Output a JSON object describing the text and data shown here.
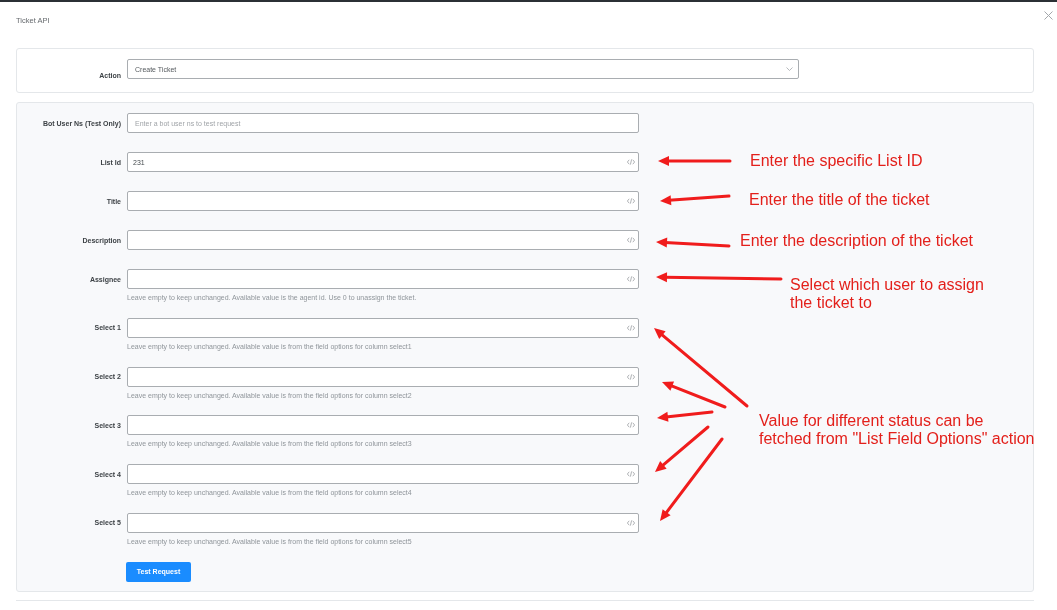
{
  "dialog": {
    "title": "Ticket API"
  },
  "action": {
    "label": "Action",
    "value": "Create Ticket"
  },
  "fields": [
    {
      "label": "Bot User Ns (Test Only)",
      "placeholder": "Enter a bot user ns to test request",
      "code_icon": false
    },
    {
      "label": "List Id",
      "value": "231",
      "code_icon": true
    },
    {
      "label": "Title",
      "code_icon": true
    },
    {
      "label": "Description",
      "code_icon": true
    },
    {
      "label": "Assignee",
      "code_icon": true,
      "hint": "Leave empty to keep unchanged. Available value is the agent id. Use 0 to unassign the ticket."
    },
    {
      "label": "Select 1",
      "code_icon": true,
      "hint": "Leave empty to keep unchanged. Available value is from the field options for column select1"
    },
    {
      "label": "Select 2",
      "code_icon": true,
      "hint": "Leave empty to keep unchanged. Available value is from the field options for column select2"
    },
    {
      "label": "Select 3",
      "code_icon": true,
      "hint": "Leave empty to keep unchanged. Available value is from the field options for column select3"
    },
    {
      "label": "Select 4",
      "code_icon": true,
      "hint": "Leave empty to keep unchanged. Available value is from the field options for column select4"
    },
    {
      "label": "Select 5",
      "code_icon": true,
      "hint": "Leave empty to keep unchanged. Available value is from the field options for column select5"
    }
  ],
  "submit_button": "Test Request",
  "annotations": [
    {
      "text": "Enter the specific List ID"
    },
    {
      "text": "Enter the title of the ticket"
    },
    {
      "text": "Enter the description of the ticket"
    },
    {
      "text": "Select which user to assign\nthe ticket to"
    },
    {
      "text": "Value for different status can be\nfetched from \"List Field Options\" action"
    }
  ]
}
